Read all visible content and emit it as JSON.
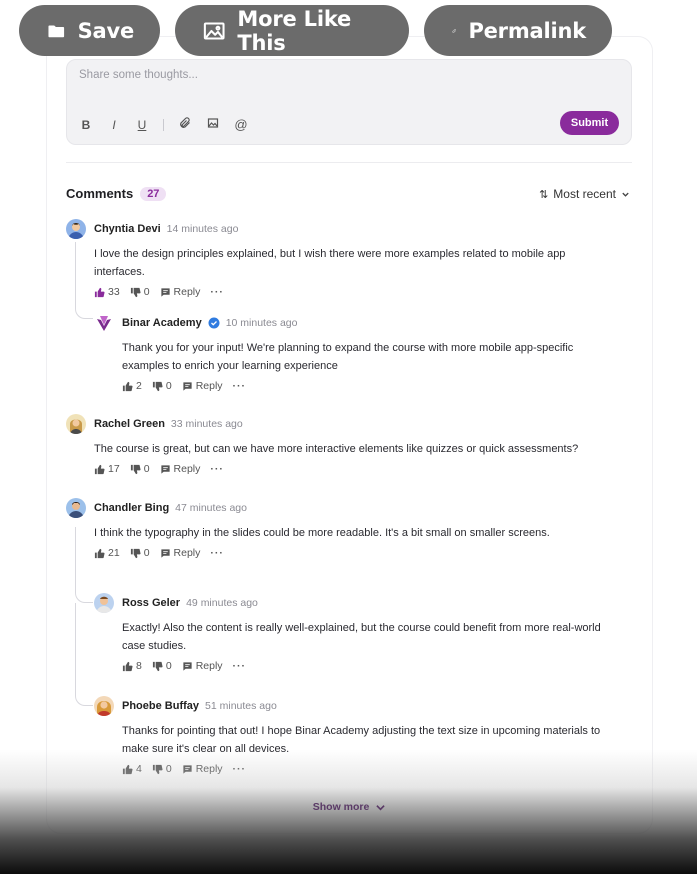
{
  "top_actions": {
    "save_label": "Save",
    "more_label": "More Like This",
    "permalink_label": "Permalink"
  },
  "composer": {
    "placeholder": "Share some thoughts...",
    "toolbar": [
      "B",
      "I",
      "U"
    ],
    "submit_label": "Submit"
  },
  "comments": {
    "title": "Comments",
    "count": "27",
    "sort_label": "Most recent",
    "show_more_label": "Show more",
    "items": [
      {
        "author": "Chyntia Devi",
        "time": "14 minutes ago",
        "text": "I love the design principles explained, but I wish there were more examples related to mobile app interfaces.",
        "likes": "33",
        "dislikes": "0",
        "reply_label": "Reply"
      },
      {
        "author": "Binar Academy",
        "time": "10 minutes ago",
        "verified": true,
        "text": "Thank you for your input! We're planning to expand the course with more mobile app-specific examples to enrich your learning experience",
        "likes": "2",
        "dislikes": "0",
        "reply_label": "Reply"
      },
      {
        "author": "Rachel Green",
        "time": "33 minutes ago",
        "text": "The course is great, but can we have more interactive elements like quizzes or quick assessments?",
        "likes": "17",
        "dislikes": "0",
        "reply_label": "Reply"
      },
      {
        "author": "Chandler Bing",
        "time": "47 minutes ago",
        "text": "I think the typography in the slides could be more readable. It's a bit small on smaller screens.",
        "likes": "21",
        "dislikes": "0",
        "reply_label": "Reply"
      },
      {
        "author": "Ross Geler",
        "time": "49 minutes ago",
        "text": "Exactly! Also the content is really well-explained, but the course could benefit from more real-world case studies.",
        "likes": "8",
        "dislikes": "0",
        "reply_label": "Reply"
      },
      {
        "author": "Phoebe Buffay",
        "time": "51 minutes ago",
        "text": "Thanks for pointing that out! I hope Binar Academy adjusting the text size in upcoming materials to make sure it's clear on all devices.",
        "likes": "4",
        "dislikes": "0",
        "reply_label": "Reply"
      }
    ]
  },
  "colors": {
    "accent": "#8a2b9c",
    "pill_bg": "#6b6b6b",
    "verified": "#2f7be0"
  }
}
